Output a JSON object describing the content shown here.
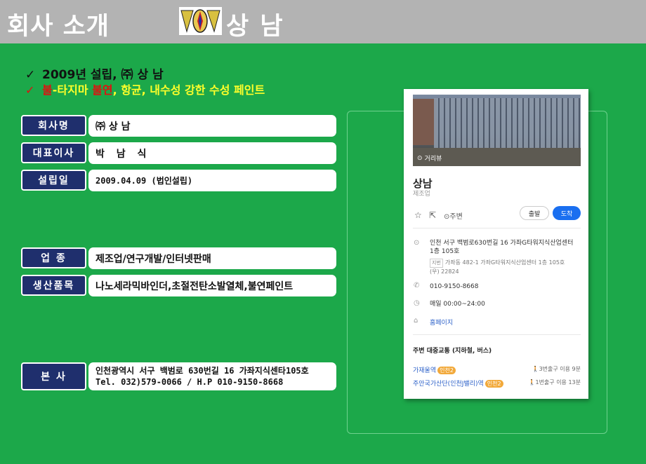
{
  "header": {
    "title": "회사 소개",
    "brand": "상 남"
  },
  "bullets": {
    "line1": "2009년 설립, ㈜ 상 남",
    "line2_part1": "불",
    "line2_part2": "-타지마 ",
    "line2_part3": "불연",
    "line2_part4": ", 항균, 내수성 강한 수성 페인트",
    "check": "✓"
  },
  "info": {
    "company_label": "회사명",
    "company_value": "㈜ 상 남",
    "ceo_label": "대표이사",
    "ceo_value": "박 남 식",
    "founded_label": "설립일",
    "founded_value": "2009.04.09 (법인설립)",
    "industry_label": "업  종",
    "industry_value": "제조업/연구개발/인터넷판매",
    "products_label": "생산품목",
    "products_value": "나노세라믹바인더,초절전탄소발열체,불연페인트",
    "hq_label": "본  사",
    "hq_address": "인천광역시 서구 백범로 630번길 16 가좌지식센타105호",
    "hq_contact": "Tel. 032)579-0066 / H.P 010-9150-8668"
  },
  "map_card": {
    "street_view": "거리뷰",
    "place_name": "상남",
    "category": "제조업",
    "save_icon": "star-icon",
    "share_icon": "share-icon",
    "nearby_label": "주변",
    "depart_label": "출발",
    "arrive_label": "도착",
    "address_line1": "인천 서구 백범로630번길 16 가좌G타워지식산업센터",
    "address_line2": "1층 105호",
    "jibun_badge": "지번",
    "jibun_address": "가좌동 482-1 가좌G타워지식산업센터 1층 105호",
    "zipcode": "(우) 22824",
    "phone": "010-9150-8668",
    "hours": "매일 00:00~24:00",
    "homepage": "홈페이지",
    "transit_title": "주변 대중교통 (지하철, 버스)",
    "transit": [
      {
        "station": "가재울역",
        "line": "인천2",
        "exit": "3번출구 이용 9분"
      },
      {
        "station": "주안국가산단(인천J밸리)역",
        "line": "인천2",
        "exit": "1번출구 이용 13분"
      }
    ]
  },
  "colors": {
    "background": "#1ca84a",
    "header": "#b3b3b3",
    "label_bg": "#1f2f6d",
    "bullet_yellow": "#ffff2a",
    "bullet_red": "#e01010",
    "arrive_button": "#1a6ff0"
  }
}
